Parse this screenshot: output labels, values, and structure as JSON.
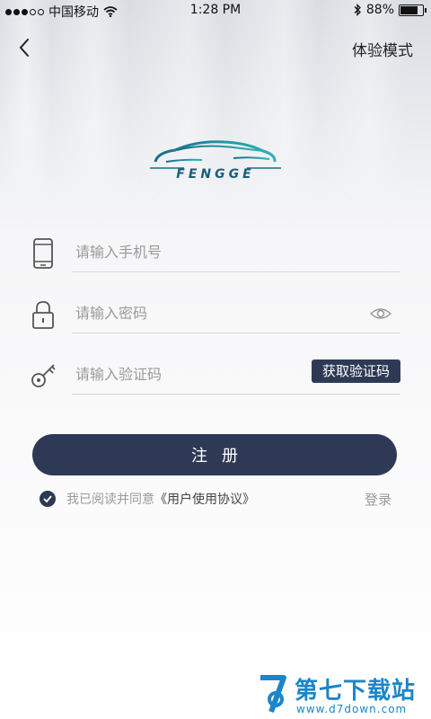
{
  "status_bar": {
    "carrier": "中国移动",
    "time": "1:28 PM",
    "battery": "88%",
    "battery_level": 0.88,
    "signal_bars_filled": 3,
    "signal_bars_total": 5
  },
  "nav": {
    "experience_mode": "体验模式"
  },
  "logo": {
    "text": "FENGGE"
  },
  "form": {
    "phone_placeholder": "请输入手机号",
    "password_placeholder": "请输入密码",
    "code_placeholder": "请输入验证码",
    "get_code_label": "获取验证码"
  },
  "register": {
    "label": "注册"
  },
  "agreement": {
    "text": "我已阅读并同意",
    "link": "《用户使用协议》",
    "checked": true
  },
  "login_label": "登录",
  "watermark": {
    "title": "第七下载站",
    "url": "www.d7down.com"
  },
  "colors": {
    "primary": "#2e3a55",
    "logo_teal": "#1a8a9e",
    "watermark_blue": "#1b86c9"
  },
  "icons": [
    "back-chevron-icon",
    "phone-icon",
    "lock-icon",
    "key-icon",
    "eye-icon",
    "checkmark-icon",
    "bluetooth-icon",
    "wifi-icon"
  ]
}
